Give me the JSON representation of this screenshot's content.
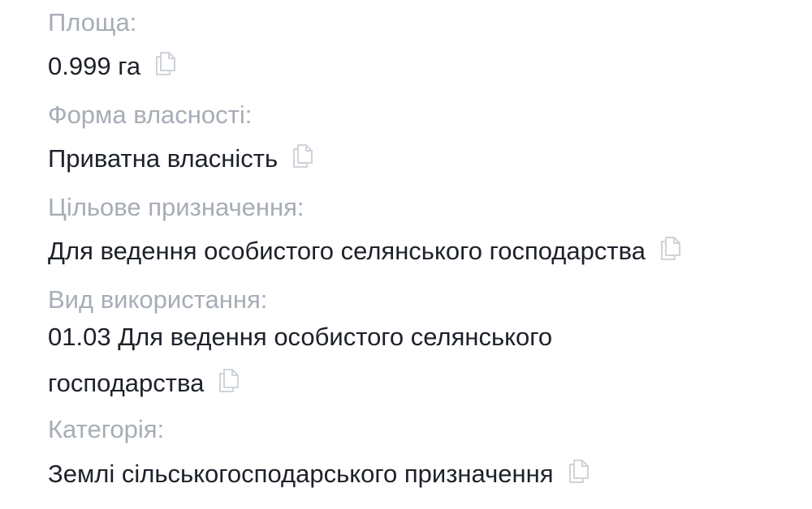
{
  "fields": [
    {
      "label": "Площа:",
      "value": "0.999 га",
      "icon": "copy-icon"
    },
    {
      "label": "Форма власності:",
      "value": "Приватна власність",
      "icon": "copy-icon"
    },
    {
      "label": "Цільове призначення:",
      "value": "Для ведення особистого селянського господарства",
      "icon": "copy-icon"
    },
    {
      "label": "Вид використання:",
      "value": "01.03 Для ведення особистого селянського господарства",
      "icon": "copy-icon"
    },
    {
      "label": "Категорія:",
      "value": "Землі сільськогосподарського призначення",
      "icon": "copy-icon"
    }
  ],
  "colors": {
    "label": "#a7adb6",
    "value": "#1d2129",
    "icon": "#cfd3d9",
    "background": "#ffffff"
  }
}
